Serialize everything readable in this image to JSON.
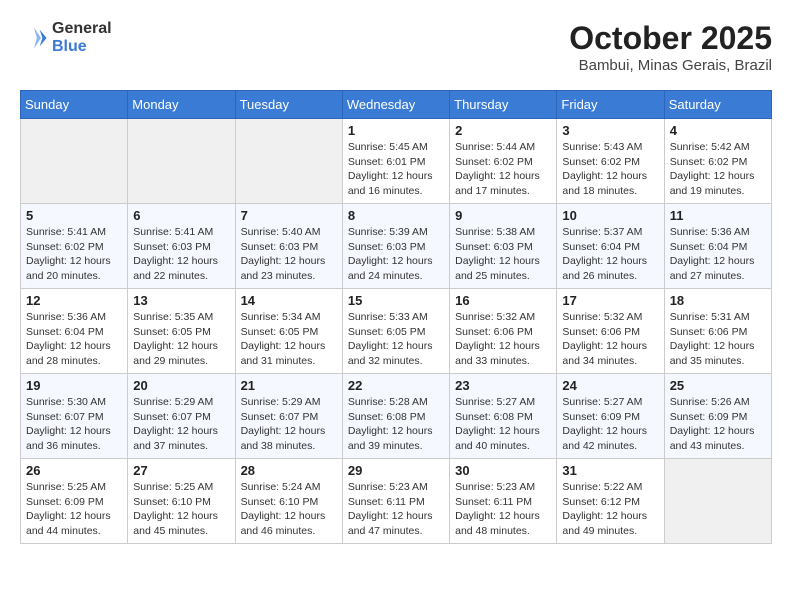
{
  "logo": {
    "general": "General",
    "blue": "Blue"
  },
  "header": {
    "month": "October 2025",
    "location": "Bambui, Minas Gerais, Brazil"
  },
  "days_of_week": [
    "Sunday",
    "Monday",
    "Tuesday",
    "Wednesday",
    "Thursday",
    "Friday",
    "Saturday"
  ],
  "weeks": [
    [
      {
        "day": "",
        "info": ""
      },
      {
        "day": "",
        "info": ""
      },
      {
        "day": "",
        "info": ""
      },
      {
        "day": "1",
        "info": "Sunrise: 5:45 AM\nSunset: 6:01 PM\nDaylight: 12 hours and 16 minutes."
      },
      {
        "day": "2",
        "info": "Sunrise: 5:44 AM\nSunset: 6:02 PM\nDaylight: 12 hours and 17 minutes."
      },
      {
        "day": "3",
        "info": "Sunrise: 5:43 AM\nSunset: 6:02 PM\nDaylight: 12 hours and 18 minutes."
      },
      {
        "day": "4",
        "info": "Sunrise: 5:42 AM\nSunset: 6:02 PM\nDaylight: 12 hours and 19 minutes."
      }
    ],
    [
      {
        "day": "5",
        "info": "Sunrise: 5:41 AM\nSunset: 6:02 PM\nDaylight: 12 hours and 20 minutes."
      },
      {
        "day": "6",
        "info": "Sunrise: 5:41 AM\nSunset: 6:03 PM\nDaylight: 12 hours and 22 minutes."
      },
      {
        "day": "7",
        "info": "Sunrise: 5:40 AM\nSunset: 6:03 PM\nDaylight: 12 hours and 23 minutes."
      },
      {
        "day": "8",
        "info": "Sunrise: 5:39 AM\nSunset: 6:03 PM\nDaylight: 12 hours and 24 minutes."
      },
      {
        "day": "9",
        "info": "Sunrise: 5:38 AM\nSunset: 6:03 PM\nDaylight: 12 hours and 25 minutes."
      },
      {
        "day": "10",
        "info": "Sunrise: 5:37 AM\nSunset: 6:04 PM\nDaylight: 12 hours and 26 minutes."
      },
      {
        "day": "11",
        "info": "Sunrise: 5:36 AM\nSunset: 6:04 PM\nDaylight: 12 hours and 27 minutes."
      }
    ],
    [
      {
        "day": "12",
        "info": "Sunrise: 5:36 AM\nSunset: 6:04 PM\nDaylight: 12 hours and 28 minutes."
      },
      {
        "day": "13",
        "info": "Sunrise: 5:35 AM\nSunset: 6:05 PM\nDaylight: 12 hours and 29 minutes."
      },
      {
        "day": "14",
        "info": "Sunrise: 5:34 AM\nSunset: 6:05 PM\nDaylight: 12 hours and 31 minutes."
      },
      {
        "day": "15",
        "info": "Sunrise: 5:33 AM\nSunset: 6:05 PM\nDaylight: 12 hours and 32 minutes."
      },
      {
        "day": "16",
        "info": "Sunrise: 5:32 AM\nSunset: 6:06 PM\nDaylight: 12 hours and 33 minutes."
      },
      {
        "day": "17",
        "info": "Sunrise: 5:32 AM\nSunset: 6:06 PM\nDaylight: 12 hours and 34 minutes."
      },
      {
        "day": "18",
        "info": "Sunrise: 5:31 AM\nSunset: 6:06 PM\nDaylight: 12 hours and 35 minutes."
      }
    ],
    [
      {
        "day": "19",
        "info": "Sunrise: 5:30 AM\nSunset: 6:07 PM\nDaylight: 12 hours and 36 minutes."
      },
      {
        "day": "20",
        "info": "Sunrise: 5:29 AM\nSunset: 6:07 PM\nDaylight: 12 hours and 37 minutes."
      },
      {
        "day": "21",
        "info": "Sunrise: 5:29 AM\nSunset: 6:07 PM\nDaylight: 12 hours and 38 minutes."
      },
      {
        "day": "22",
        "info": "Sunrise: 5:28 AM\nSunset: 6:08 PM\nDaylight: 12 hours and 39 minutes."
      },
      {
        "day": "23",
        "info": "Sunrise: 5:27 AM\nSunset: 6:08 PM\nDaylight: 12 hours and 40 minutes."
      },
      {
        "day": "24",
        "info": "Sunrise: 5:27 AM\nSunset: 6:09 PM\nDaylight: 12 hours and 42 minutes."
      },
      {
        "day": "25",
        "info": "Sunrise: 5:26 AM\nSunset: 6:09 PM\nDaylight: 12 hours and 43 minutes."
      }
    ],
    [
      {
        "day": "26",
        "info": "Sunrise: 5:25 AM\nSunset: 6:09 PM\nDaylight: 12 hours and 44 minutes."
      },
      {
        "day": "27",
        "info": "Sunrise: 5:25 AM\nSunset: 6:10 PM\nDaylight: 12 hours and 45 minutes."
      },
      {
        "day": "28",
        "info": "Sunrise: 5:24 AM\nSunset: 6:10 PM\nDaylight: 12 hours and 46 minutes."
      },
      {
        "day": "29",
        "info": "Sunrise: 5:23 AM\nSunset: 6:11 PM\nDaylight: 12 hours and 47 minutes."
      },
      {
        "day": "30",
        "info": "Sunrise: 5:23 AM\nSunset: 6:11 PM\nDaylight: 12 hours and 48 minutes."
      },
      {
        "day": "31",
        "info": "Sunrise: 5:22 AM\nSunset: 6:12 PM\nDaylight: 12 hours and 49 minutes."
      },
      {
        "day": "",
        "info": ""
      }
    ]
  ]
}
